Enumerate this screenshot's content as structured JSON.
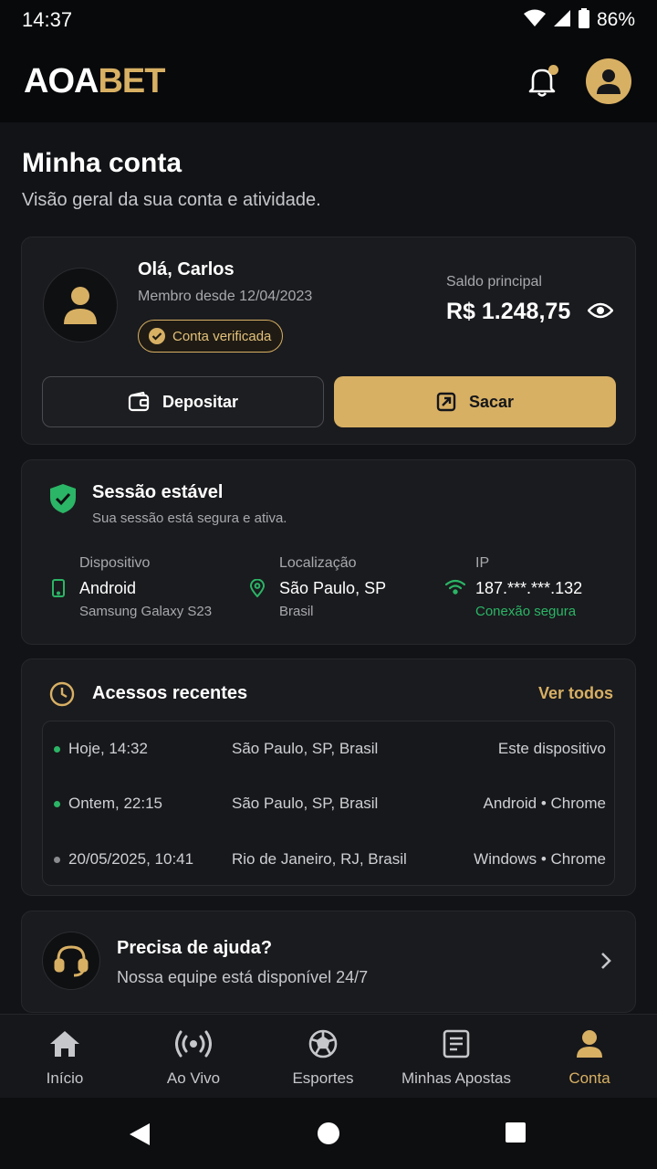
{
  "status_bar": {
    "time": "14:37",
    "battery": "86%"
  },
  "app": {
    "logo_part1": "AOA",
    "logo_part2": "BET"
  },
  "page": {
    "title": "Minha conta",
    "subtitle": "Visão geral da sua conta e atividade."
  },
  "profile": {
    "greeting": "Olá, Carlos",
    "member_since": "Membro desde 12/04/2023",
    "verified_label": "Conta verificada",
    "balance_label": "Saldo principal",
    "balance_value": "R$ 1.248,75",
    "deposit_label": "Depositar",
    "withdraw_label": "Sacar"
  },
  "session": {
    "title": "Sessão estável",
    "subtitle": "Sua sessão está segura e ativa.",
    "device": {
      "label": "Dispositivo",
      "value": "Android",
      "sub": "Samsung Galaxy S23"
    },
    "location": {
      "label": "Localização",
      "value": "São Paulo, SP",
      "sub": "Brasil"
    },
    "ip": {
      "label": "IP",
      "value": "187.***.***.132",
      "sub": "Conexão segura"
    }
  },
  "access": {
    "title": "Acessos recentes",
    "view_all": "Ver todos",
    "rows": [
      {
        "when": "Hoje, 14:32",
        "where": "São Paulo, SP, Brasil",
        "device": "Este dispositivo",
        "status_color": "#2bb566"
      },
      {
        "when": "Ontem, 22:15",
        "where": "São Paulo, SP, Brasil",
        "device": "Android • Chrome",
        "status_color": "#2bb566"
      },
      {
        "when": "20/05/2025, 10:41",
        "where": "Rio de Janeiro, RJ, Brasil",
        "device": "Windows • Chrome",
        "status_color": "#8a8b8f"
      }
    ]
  },
  "help": {
    "title": "Precisa de ajuda?",
    "subtitle": "Nossa equipe está disponível 24/7"
  },
  "bottom_nav": [
    {
      "label": "Início",
      "icon": "home-icon"
    },
    {
      "label": "Ao Vivo",
      "icon": "live-icon"
    },
    {
      "label": "Esportes",
      "icon": "soccer-ball-icon"
    },
    {
      "label": "Minhas Apostas",
      "icon": "ticket-icon"
    },
    {
      "label": "Conta",
      "icon": "user-icon",
      "active": true
    }
  ],
  "colors": {
    "accent": "#d8b064",
    "success": "#2bb566",
    "background": "#121316",
    "card": "#1a1b1e"
  }
}
